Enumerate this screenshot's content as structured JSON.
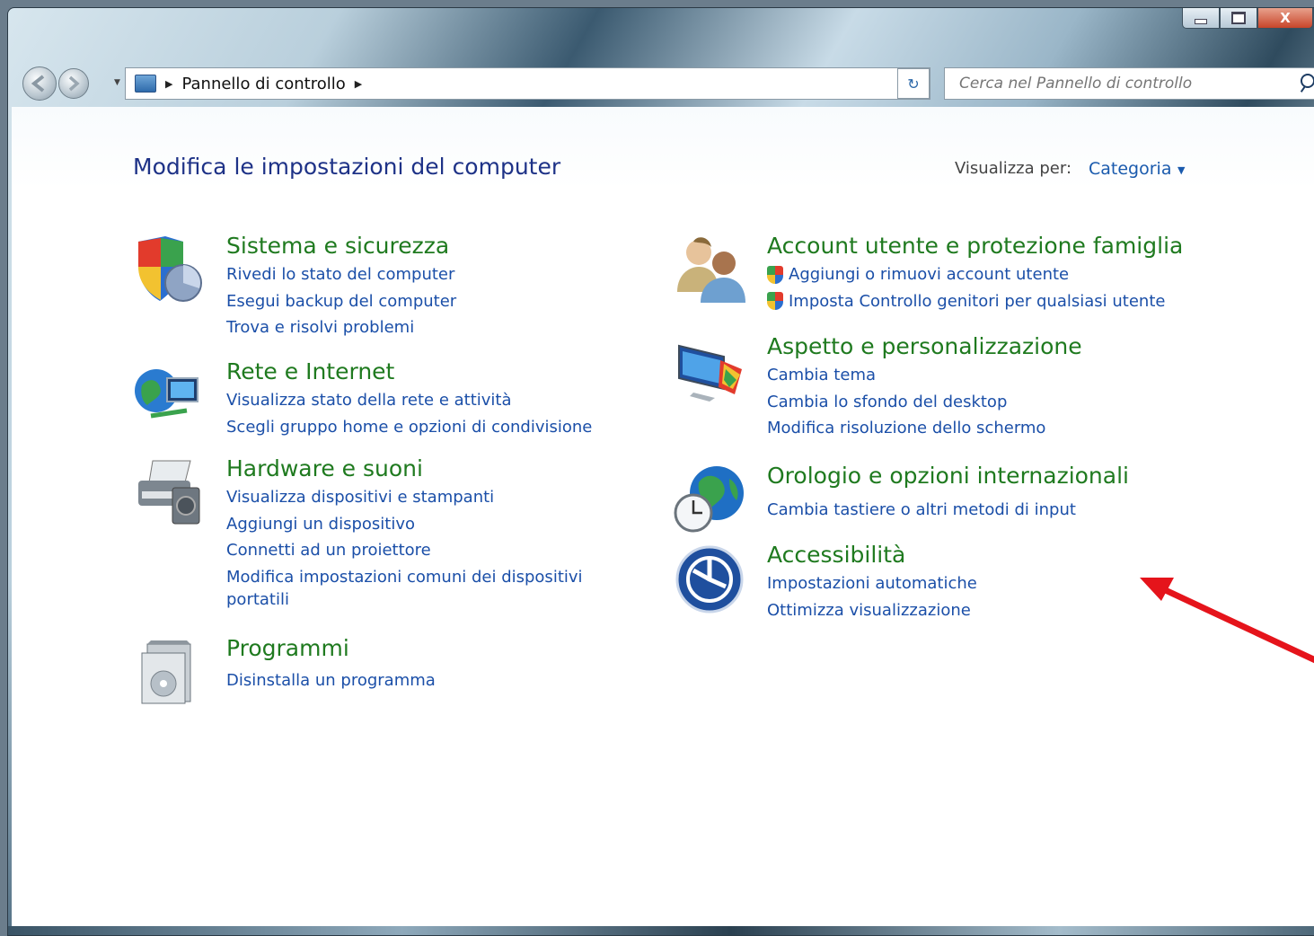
{
  "window": {
    "caption_buttons": [
      "minimize-icon",
      "maximize-icon",
      "close-icon"
    ],
    "close_glyph": "X"
  },
  "nav": {
    "breadcrumb": [
      "Pannello di controllo"
    ],
    "search_placeholder": "Cerca nel Pannello di controllo"
  },
  "header": {
    "title": "Modifica le impostazioni del computer",
    "view_by_label": "Visualizza per:",
    "view_by_value": "Categoria"
  },
  "categories": {
    "left": [
      {
        "title": "Sistema e sicurezza",
        "icon": "system-security-icon",
        "links": [
          "Rivedi lo stato del computer",
          "Esegui backup del computer",
          "Trova e risolvi problemi"
        ]
      },
      {
        "title": "Rete e Internet",
        "icon": "network-icon",
        "links": [
          "Visualizza stato della rete e attività",
          "Scegli gruppo home e opzioni di condivisione"
        ]
      },
      {
        "title": "Hardware e suoni",
        "icon": "printer-icon",
        "links": [
          "Visualizza dispositivi e stampanti",
          "Aggiungi un dispositivo",
          "Connetti ad un proiettore",
          "Modifica impostazioni comuni dei dispositivi",
          "portatili"
        ]
      },
      {
        "title": "Programmi",
        "icon": "programs-icon",
        "links": [
          "Disinstalla un programma"
        ]
      }
    ],
    "right": [
      {
        "title": "Account utente e protezione famiglia",
        "icon": "users-icon",
        "links": [
          "Aggiungi o rimuovi account utente",
          "Imposta Controllo genitori per qualsiasi utente"
        ]
      },
      {
        "title": "Aspetto e personalizzazione",
        "icon": "appearance-icon",
        "links": [
          "Cambia tema",
          "Cambia lo sfondo del desktop",
          "Modifica risoluzione dello schermo"
        ]
      },
      {
        "title": "Orologio e opzioni internazionali",
        "icon": "clock-globe-icon",
        "links": [
          "Cambia tastiere o altri metodi di input"
        ]
      },
      {
        "title": "Accessibilità",
        "icon": "accessibility-icon",
        "links": [
          "Impostazioni automatiche",
          "Ottimizza visualizzazione"
        ]
      }
    ]
  },
  "annotation": {
    "color": "#e5141b"
  },
  "colors": {
    "title_green": "#1f7a1f",
    "link_blue": "#1b4fa8",
    "header_blue": "#1e3287"
  }
}
